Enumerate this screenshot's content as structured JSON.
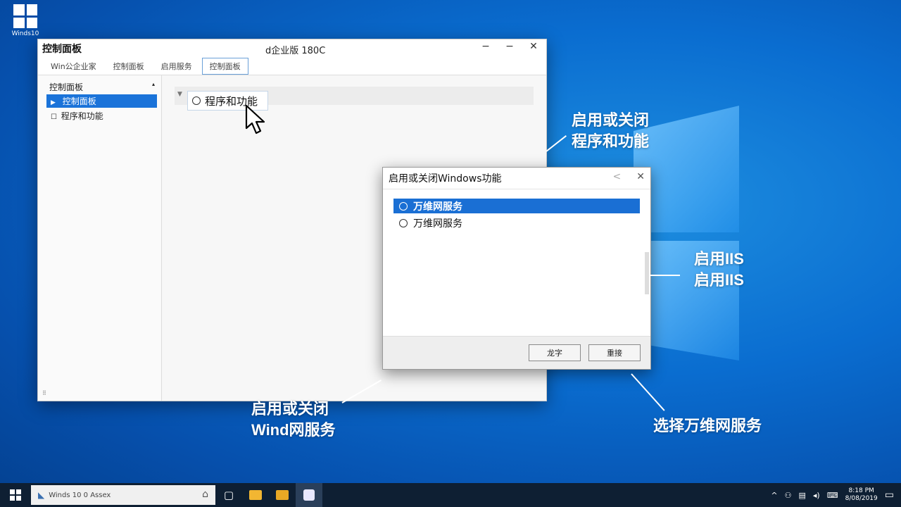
{
  "desktop": {
    "icon_label": "Winds10"
  },
  "control_panel": {
    "title": "控制面板",
    "center_title": "d企业版 180C",
    "controls": {
      "minimize": "−",
      "maximize": "−",
      "close": "✕"
    },
    "tabs": [
      "Win公企业家",
      "控制面板",
      "启用服务",
      "控制面板"
    ],
    "sidebar": {
      "header": "控制面板",
      "header_caret": "▴",
      "items": [
        {
          "icon": "▶",
          "label": "控制面板"
        },
        {
          "icon": "☐",
          "label": "程序和功能"
        }
      ],
      "footer": "⠿"
    },
    "main": {
      "row_marker": "▼",
      "item_label": "程序和功能"
    }
  },
  "dialog": {
    "title": "启用或关闭Windows功能",
    "controls": {
      "back": "<",
      "close": "✕"
    },
    "items": [
      {
        "label": "万维网服务"
      },
      {
        "label": "万维网服务"
      }
    ],
    "buttons": {
      "ok": "龙字",
      "cancel": "重接"
    }
  },
  "annotations": {
    "top_right": [
      "启用或关闭",
      "程序和功能"
    ],
    "middle_right": [
      "启用IIS",
      "启用IIS"
    ],
    "bottom_left": [
      "启用或关闭",
      "Wind网服务"
    ],
    "bottom_right": "选择万维网服务"
  },
  "taskbar": {
    "search_text": "Winds 10 0 Assex",
    "search_home": "⌂",
    "tray": {
      "chevron": "^",
      "clock_line1": "8:18 PM",
      "clock_line2": "8/08/2019",
      "notification": "▭"
    }
  },
  "colors": {
    "accent": "#1a73d9",
    "desktop": "#0a6dd0"
  }
}
